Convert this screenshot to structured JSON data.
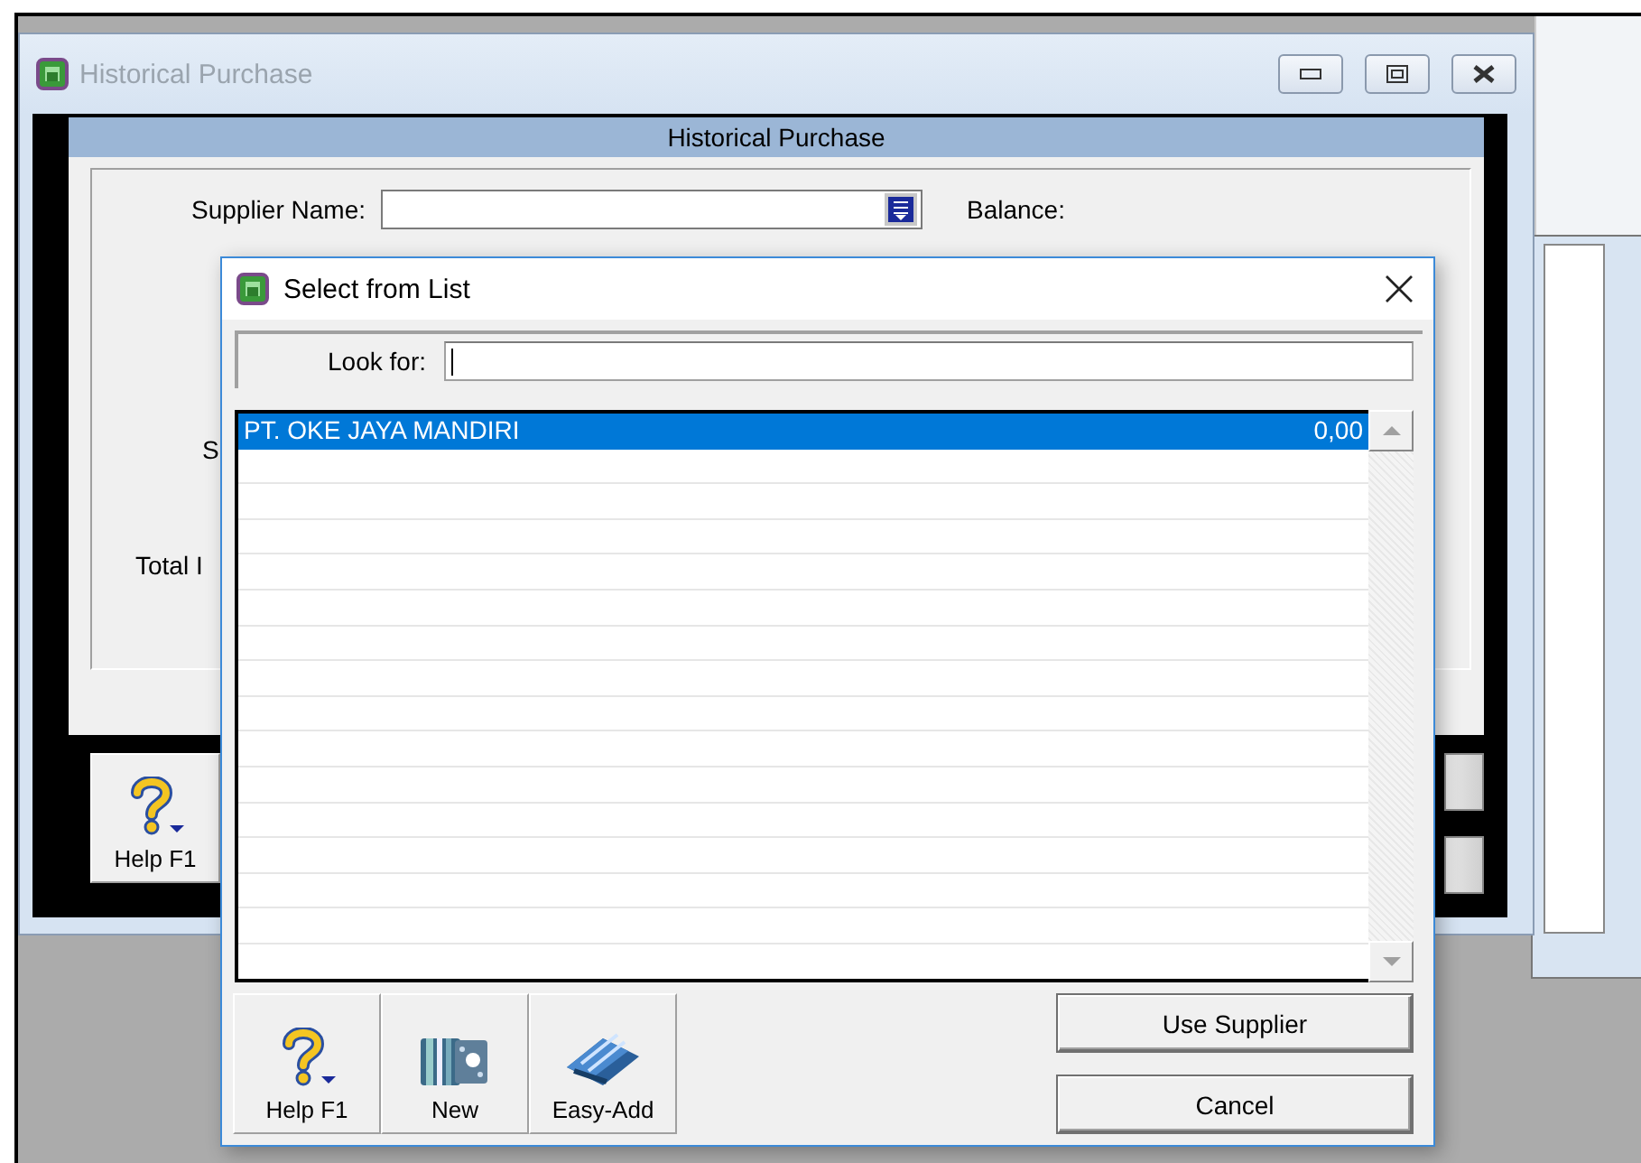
{
  "main_window": {
    "title": "Historical Purchase",
    "header": "Historical Purchase",
    "form": {
      "supplier_label": "Supplier Name:",
      "balance_label": "Balance:",
      "partial_labels": [
        "S",
        "Total I"
      ]
    },
    "toolbar": [
      {
        "label": "Help F1",
        "kind": "help"
      }
    ]
  },
  "dialog": {
    "title": "Select from List",
    "look_for_label": "Look for:",
    "list": {
      "rows": [
        {
          "name": "PT. OKE JAYA MANDIRI",
          "balance": "0,00",
          "selected": true
        }
      ]
    },
    "toolbar": [
      {
        "label": "Help F1",
        "kind": "help"
      },
      {
        "label": "New",
        "kind": "new"
      },
      {
        "label": "Easy-Add",
        "kind": "easy-add"
      }
    ],
    "buttons": [
      "Use Supplier",
      "Cancel"
    ]
  }
}
